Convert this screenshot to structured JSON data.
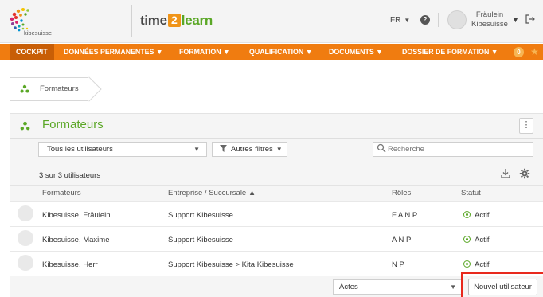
{
  "header": {
    "logo_text": "kibesuisse",
    "brand": {
      "part1": "time",
      "part2": "2",
      "part3": "learn"
    },
    "language": "FR",
    "help_label": "?",
    "user_name_line1": "Fräulein",
    "user_name_line2": "Kibesuisse"
  },
  "nav": {
    "items": [
      {
        "label": "COCKPIT"
      },
      {
        "label": "DONNÉES PERMANENTES ▼"
      },
      {
        "label": "FORMATION ▼"
      },
      {
        "label": "QUALIFICATION ▼"
      },
      {
        "label": "DOCUMENTS ▼"
      },
      {
        "label": "DOSSIER DE FORMATION ▼"
      }
    ],
    "badge": "0"
  },
  "breadcrumb": {
    "label": "Formateurs"
  },
  "panel": {
    "title": "Formateurs",
    "filter_select": "Tous les utilisateurs",
    "other_filters": "Autres filtres",
    "search_placeholder": "Recherche",
    "count": "3 sur 3 utilisateurs",
    "columns": [
      "Formateurs",
      "Entreprise / Succursale ▲",
      "Rôles",
      "Statut"
    ],
    "rows": [
      {
        "name": "Kibesuisse, Fräulein",
        "company": "Support Kibesuisse",
        "roles": "F A N P",
        "status": "Actif"
      },
      {
        "name": "Kibesuisse, Maxime",
        "company": "Support Kibesuisse",
        "roles": "A N P",
        "status": "Actif"
      },
      {
        "name": "Kibesuisse, Herr",
        "company": "Support Kibesuisse > Kita Kibesuisse",
        "roles": "N P",
        "status": "Actif"
      }
    ],
    "actions_select": "Actes",
    "new_user_button": "Nouvel utilisateur"
  },
  "colors": {
    "accent_orange": "#f07c10",
    "accent_green": "#5aa726",
    "highlight_red": "#e8291d"
  },
  "icons": [
    "logo-dots",
    "help-icon",
    "user-avatar-icon",
    "logout-icon",
    "star-icon",
    "person-group-icon",
    "kebab-menu-icon",
    "filter-icon",
    "search-icon",
    "download-icon",
    "gear-icon",
    "radio-active-icon"
  ]
}
